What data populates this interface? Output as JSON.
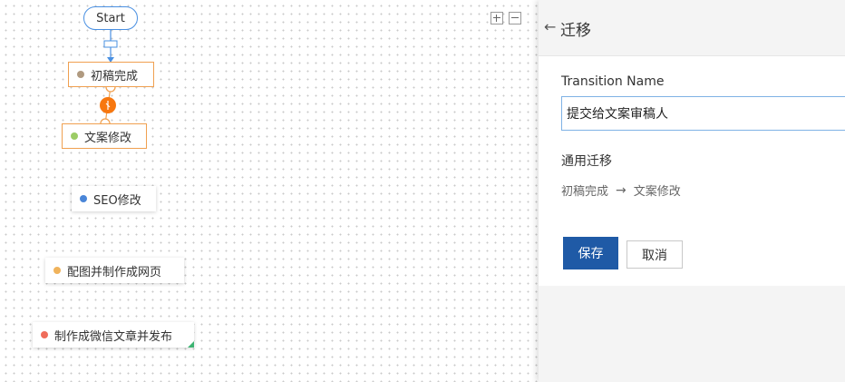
{
  "canvas": {
    "start_label": "Start",
    "zoom_in_icon": "plus-icon",
    "zoom_out_icon": "minus-icon",
    "transition_icon": "transition-link-icon",
    "transition_color": "#f7770f",
    "nodes": [
      {
        "label": "初稿完成",
        "color": "#b09a80",
        "selected": true
      },
      {
        "label": "文案修改",
        "color": "#9ccc65",
        "selected": true
      },
      {
        "label": "SEO修改",
        "color": "#4a86d8",
        "selected": false
      },
      {
        "label": "配图并制作成网页",
        "color": "#f0b35c",
        "selected": false
      },
      {
        "label": "制作成微信文章并发布",
        "color": "#ef6c5a",
        "selected": false
      }
    ]
  },
  "panel": {
    "back_icon": "arrow-left-icon",
    "title": "迁移",
    "field_label": "Transition Name",
    "name_value": "提交给文案审稿人",
    "section_label": "通用迁移",
    "from_state": "初稿完成",
    "to_state": "文案修改",
    "arrow_icon": "arrow-right-icon",
    "save_label": "保存",
    "cancel_label": "取消",
    "primary_color": "#1f5aa6"
  }
}
